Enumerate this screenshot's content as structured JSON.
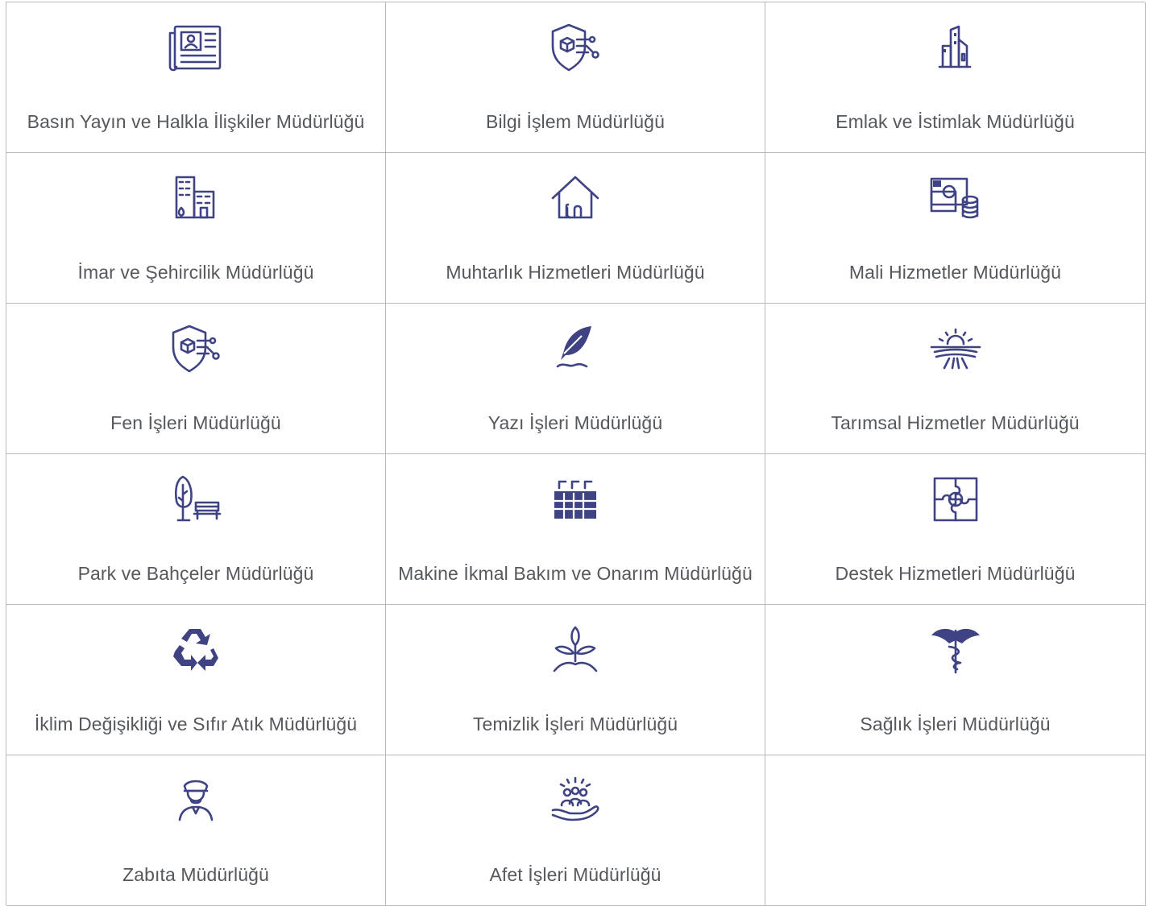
{
  "directorates": [
    {
      "label": "Basın Yayın ve Halkla İlişkiler Müdürlüğü",
      "icon": "newspaper-icon"
    },
    {
      "label": "Bilgi İşlem Müdürlüğü",
      "icon": "network-shield-icon"
    },
    {
      "label": "Emlak ve İstimlak Müdürlüğü",
      "icon": "real-estate-icon"
    },
    {
      "label": "İmar ve Şehircilik Müdürlüğü",
      "icon": "city-buildings-icon"
    },
    {
      "label": "Muhtarlık Hizmetleri Müdürlüğü",
      "icon": "house-icon"
    },
    {
      "label": "Mali Hizmetler Müdürlüğü",
      "icon": "money-coins-icon"
    },
    {
      "label": "Fen İşleri Müdürlüğü",
      "icon": "network-shield-icon"
    },
    {
      "label": "Yazı İşleri Müdürlüğü",
      "icon": "feather-pen-icon"
    },
    {
      "label": "Tarımsal Hizmetler Müdürlüğü",
      "icon": "sun-field-icon"
    },
    {
      "label": "Park ve Bahçeler Müdürlüğü",
      "icon": "park-bench-icon"
    },
    {
      "label": "Makine İkmal Bakım ve Onarım Müdürlüğü",
      "icon": "factory-icon"
    },
    {
      "label": "Destek Hizmetleri Müdürlüğü",
      "icon": "puzzle-support-icon"
    },
    {
      "label": "İklim Değişikliği ve Sıfır Atık Müdürlüğü",
      "icon": "recycle-icon"
    },
    {
      "label": "Temizlik İşleri Müdürlüğü",
      "icon": "sprout-icon"
    },
    {
      "label": "Sağlık İşleri Müdürlüğü",
      "icon": "caduceus-icon"
    },
    {
      "label": "Zabıta Müdürlüğü",
      "icon": "officer-icon"
    },
    {
      "label": "Afet İşleri Müdürlüğü",
      "icon": "people-hand-icon"
    }
  ],
  "colors": {
    "icon": "#3f4384",
    "text": "#55585c",
    "border": "#b9b9b9"
  }
}
